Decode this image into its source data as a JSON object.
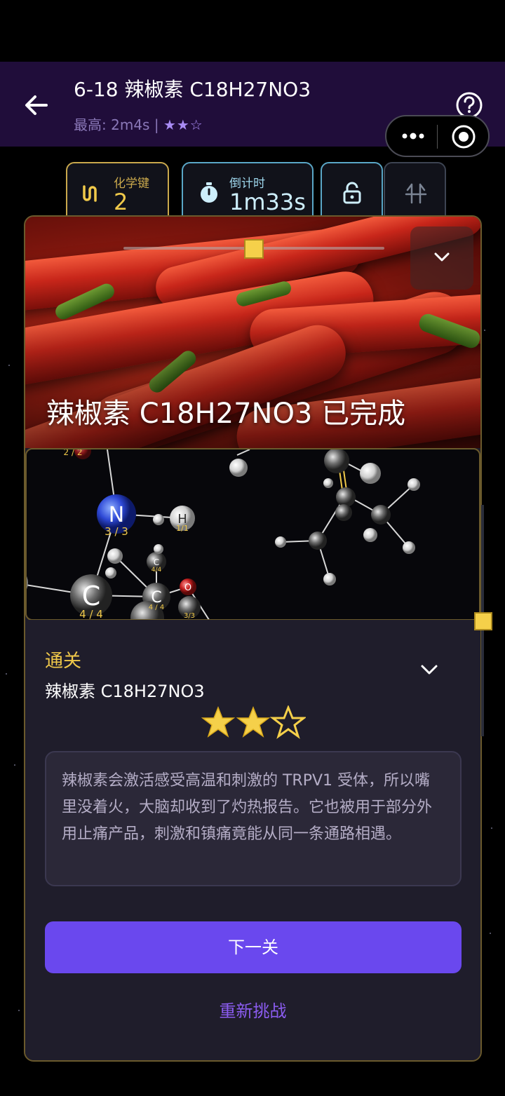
{
  "header": {
    "title": "6-18 辣椒素 C18H27NO3",
    "best_label": "最高:",
    "best_time": "2m4s",
    "separator": "|",
    "best_stars": "★★☆"
  },
  "stats": {
    "bonds_label": "化学键",
    "bonds_value": "2",
    "timer_label": "倒计时",
    "timer_value": "1m33s"
  },
  "banner": {
    "completed_text": "辣椒素 C18H27NO3 已完成"
  },
  "molecule": {
    "atoms": [
      {
        "symbol": "N",
        "capacity": "3 / 3"
      },
      {
        "symbol": "H",
        "capacity": "1/1"
      },
      {
        "symbol": "C",
        "capacity": "4 / 4"
      },
      {
        "symbol": "C",
        "capacity": "4 / 4"
      },
      {
        "symbol": "C",
        "capacity": "4/4"
      },
      {
        "symbol": "O",
        "capacity": "3/3"
      },
      {
        "symbol": "H",
        "capacity": "1/1"
      }
    ],
    "corner_badge": "2 / 2"
  },
  "result": {
    "status": "通关",
    "molecule_name": "辣椒素 C18H27NO3",
    "stars_earned": 2,
    "stars_total": 3,
    "fact": "辣椒素会激活感受高温和刺激的 TRPV1 受体，所以嘴里没着火，大脑却收到了灼热报告。它也被用于部分外用止痛产品，刺激和镇痛竟能从同一条通路相遇。",
    "next_label": "下一关",
    "retry_label": "重新挑战"
  },
  "colors": {
    "accent_gold": "#f0c94a",
    "accent_purple": "#6a48ee",
    "header_bg": "#200d3a"
  },
  "icons": [
    "back-arrow-icon",
    "help-icon",
    "more-dots-icon",
    "target-icon",
    "bond-icon",
    "stopwatch-icon",
    "lock-icon",
    "split-icon",
    "chevron-down-icon",
    "star-icon"
  ]
}
